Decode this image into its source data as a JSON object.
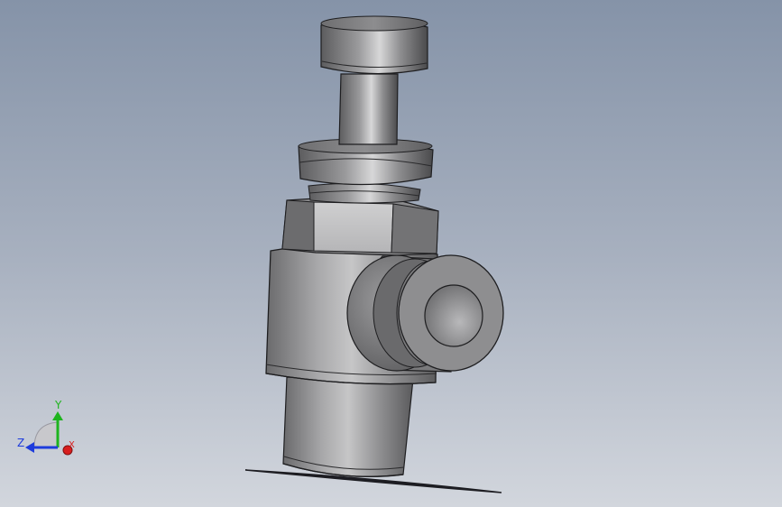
{
  "viewport": {
    "background_top": "#8593a8",
    "background_bottom": "#d2d6dd"
  },
  "model": {
    "part_color": "#7e7e80",
    "edge_color": "#1e1e20",
    "highlight_color": "#d7d7d8"
  },
  "triad": {
    "x_label": "X",
    "y_label": "Y",
    "z_label": "Z",
    "x_color": "#d81e1e",
    "y_color": "#1eb41e",
    "z_color": "#1e3cdc"
  }
}
